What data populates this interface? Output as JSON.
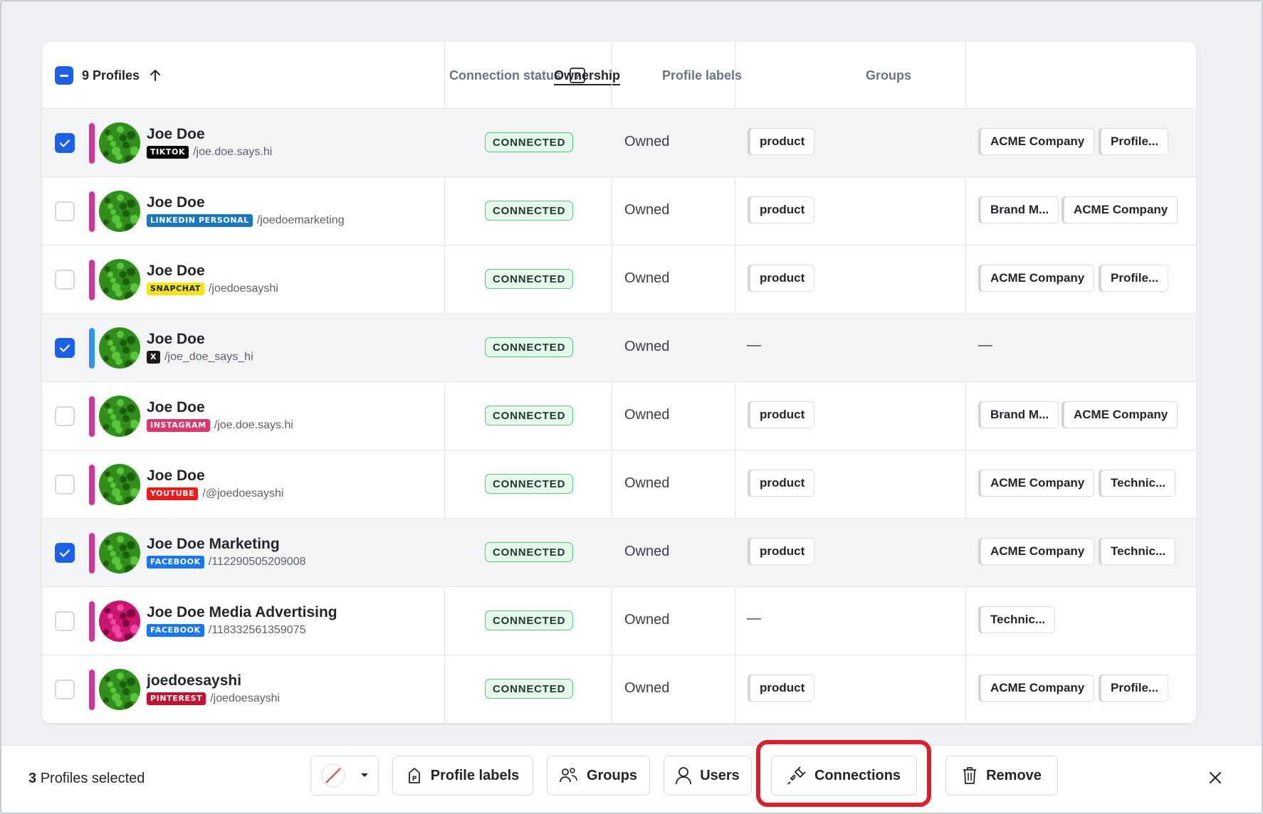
{
  "header": {
    "profiles_label": "9 Profiles",
    "connection_status": "Connection status",
    "ownership": "Ownership",
    "profile_labels": "Profile labels",
    "groups": "Groups"
  },
  "rows": [
    {
      "name": "Joe Doe",
      "network": "TIKTOK",
      "handle": "/joe.doe.says.hi",
      "status": "CONNECTED",
      "ownership": "Owned",
      "label": "product",
      "groups": [
        "ACME Company",
        "Profile..."
      ],
      "selected": true
    },
    {
      "name": "Joe Doe",
      "network": "LINKEDIN PERSONAL",
      "handle": "/joedoemarketing",
      "status": "CONNECTED",
      "ownership": "Owned",
      "label": "product",
      "groups": [
        "Brand M...",
        "ACME Company"
      ],
      "selected": false
    },
    {
      "name": "Joe Doe",
      "network": "SNAPCHAT",
      "handle": "/joedoesayshi",
      "status": "CONNECTED",
      "ownership": "Owned",
      "label": "product",
      "groups": [
        "ACME Company",
        "Profile..."
      ],
      "selected": false
    },
    {
      "name": "Joe Doe",
      "network": "X",
      "handle": "/joe_doe_says_hi",
      "status": "CONNECTED",
      "ownership": "Owned",
      "label": "—",
      "groups_empty": "—",
      "selected": true
    },
    {
      "name": "Joe Doe",
      "network": "INSTAGRAM",
      "handle": "/joe.doe.says.hi",
      "status": "CONNECTED",
      "ownership": "Owned",
      "label": "product",
      "groups": [
        "Brand M...",
        "ACME Company"
      ],
      "selected": false
    },
    {
      "name": "Joe Doe",
      "network": "YOUTUBE",
      "handle": "/@joedoesayshi",
      "status": "CONNECTED",
      "ownership": "Owned",
      "label": "product",
      "groups": [
        "ACME Company",
        "Technic..."
      ],
      "selected": false
    },
    {
      "name": "Joe Doe Marketing",
      "network": "FACEBOOK",
      "handle": "/112290505209008",
      "status": "CONNECTED",
      "ownership": "Owned",
      "label": "product",
      "groups": [
        "ACME Company",
        "Technic..."
      ],
      "selected": true
    },
    {
      "name": "Joe Doe Media Advertising",
      "network": "FACEBOOK",
      "handle": "/118332561359075",
      "status": "CONNECTED",
      "ownership": "Owned",
      "label": "—",
      "groups": [
        "Technic..."
      ],
      "selected": false
    },
    {
      "name": "joedoesayshi",
      "network": "PINTEREST",
      "handle": "/joedoesayshi",
      "status": "CONNECTED",
      "ownership": "Owned",
      "label": "product",
      "groups": [
        "ACME Company",
        "Profile..."
      ],
      "selected": false
    }
  ],
  "colors": {
    "accent_blue": "#1d5fe6",
    "connected_border": "#5ec27a",
    "highlight_red": "#d8202f",
    "tiktok": "#000000",
    "linkedin": "#1a78c2",
    "snapchat": "#f2e51a",
    "x": "#1b1b1b",
    "instagram": "#e0356a",
    "youtube": "#f01818",
    "facebook": "#1877f2",
    "pinterest": "#c8102e"
  },
  "bottom_bar": {
    "count": "3",
    "count_suffix": "Profiles selected",
    "profile_labels": "Profile labels",
    "groups": "Groups",
    "users": "Users",
    "connections": "Connections",
    "remove": "Remove"
  },
  "icons": {
    "sort": "arrow-up-icon",
    "help": "question-icon",
    "color_picker": "no-color-icon",
    "profile_labels": "tag-icon",
    "groups": "users-group-icon",
    "users": "user-icon",
    "connections": "plug-icon",
    "remove": "trash-icon",
    "close": "close-icon"
  }
}
